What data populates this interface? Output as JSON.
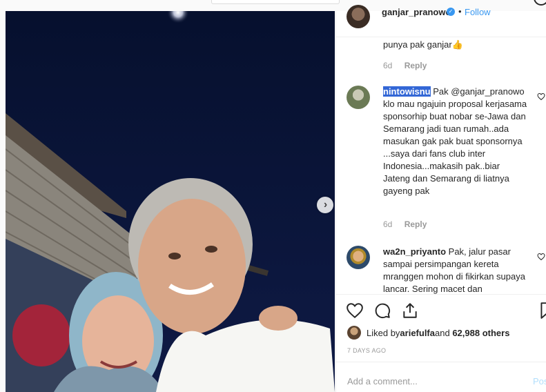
{
  "header": {
    "username": "ganjar_pranowo",
    "separator": "•",
    "follow_label": "Follow",
    "verified_glyph": "✓"
  },
  "comments": [
    {
      "user": "",
      "text": "punya pak ganjar👍",
      "age": "6d",
      "reply_label": "Reply"
    },
    {
      "user": "nintowisnu",
      "text": " Pak @ganjar_pranowo klo mau ngajuin proposal kerjasama sponsorhip buat nobar se-Jawa dan Semarang jadi tuan rumah..ada masukan gak pak buat sponsornya ...saya dari fans club inter Indonesia...makasih pak..biar Jateng dan Semarang di liatnya gayeng pak",
      "age": "6d",
      "reply_label": "Reply"
    },
    {
      "user": "wa2n_priyanto",
      "text": " Pak, jalur pasar sampai persimpangan kereta mranggen mohon di fikirkan supaya lancar. Sering macet dan",
      "age": "",
      "reply_label": ""
    }
  ],
  "likes": {
    "prefix": "Liked by ",
    "user": "ariefulfa",
    "middle": " and ",
    "count": "62,988 others"
  },
  "date_label": "7 DAYS AGO",
  "add_comment": {
    "placeholder": "Add a comment...",
    "post_label": "Post"
  },
  "icons": {
    "like": "heart-icon",
    "comment": "comment-bubble-icon",
    "share": "share-icon",
    "save": "bookmark-icon",
    "next": "chevron-right-icon"
  },
  "colors": {
    "link": "#3897f0",
    "highlight": "#3367d6",
    "text": "#262626",
    "muted": "#999999"
  }
}
